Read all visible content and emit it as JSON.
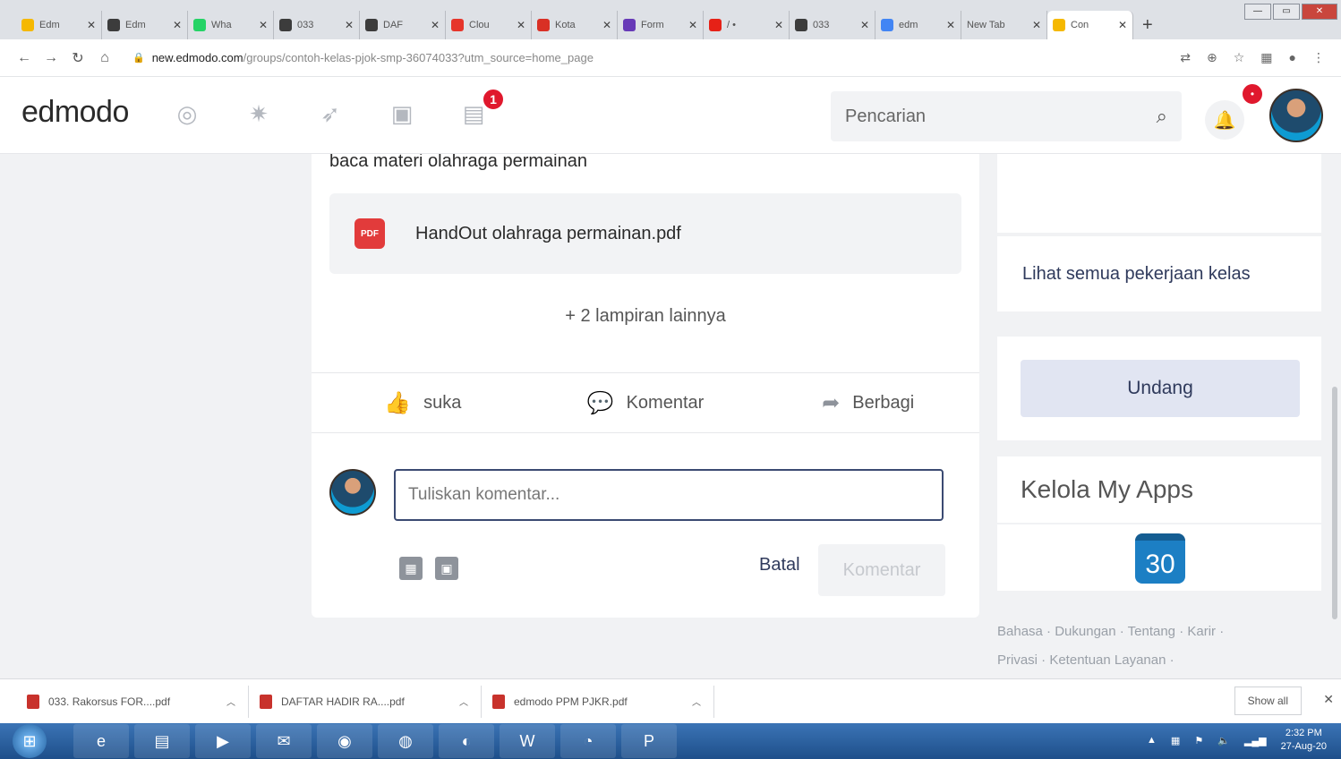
{
  "browser": {
    "tabs": [
      {
        "title": "Edm",
        "color": "#f5b800",
        "active": false
      },
      {
        "title": "Edm",
        "color": "#3c3c3c",
        "active": false
      },
      {
        "title": "Wha",
        "color": "#25d366",
        "active": false
      },
      {
        "title": "033",
        "color": "#3c3c3c",
        "active": false
      },
      {
        "title": "DAF",
        "color": "#3c3c3c",
        "active": false
      },
      {
        "title": "Clou",
        "color": "#e6352b",
        "active": false
      },
      {
        "title": "Kota",
        "color": "#d93025",
        "active": false
      },
      {
        "title": "Form",
        "color": "#673ab7",
        "active": false
      },
      {
        "title": "/ •",
        "color": "#e62117",
        "active": false
      },
      {
        "title": "033",
        "color": "#3c3c3c",
        "active": false
      },
      {
        "title": "edm",
        "color": "#4285f4",
        "active": false
      },
      {
        "title": "New Tab",
        "color": "#dee1e6",
        "active": false
      },
      {
        "title": "Con",
        "color": "#f5b800",
        "active": true
      }
    ],
    "new_tab": "+",
    "url_host": "new.edmodo.com",
    "url_path": "/groups/contoh-kelas-pjok-smp-36074033?utm_source=home_page"
  },
  "header": {
    "logo": "edmodo",
    "nav_badge": "1",
    "search_placeholder": "Pencarian",
    "bell_badge": "•"
  },
  "post": {
    "text": "baca materi olahraga permainan",
    "attachment_icon": "PDF",
    "attachment_name": "HandOut olahraga permainan.pdf",
    "more_attachments": "+ 2 lampiran lainnya",
    "actions": {
      "like": "suka",
      "comment": "Komentar",
      "share": "Berbagi"
    },
    "comment_placeholder": "Tuliskan komentar...",
    "cancel": "Batal",
    "submit": "Komentar"
  },
  "sidebar": {
    "see_all": "Lihat semua pekerjaan kelas",
    "invite": "Undang",
    "manage_apps": "Kelola My Apps",
    "app_icon_number": "30",
    "footer_line1": "Bahasa · Dukungan · Tentang · Karir ·",
    "footer_line2": "Privasi · Ketentuan Layanan ·"
  },
  "downloads": {
    "items": [
      "033. Rakorsus FOR....pdf",
      "DAFTAR HADIR RA....pdf",
      "edmodo PPM PJKR.pdf"
    ],
    "show_all": "Show all"
  },
  "taskbar": {
    "time": "2:32 PM",
    "date": "27-Aug-20"
  }
}
